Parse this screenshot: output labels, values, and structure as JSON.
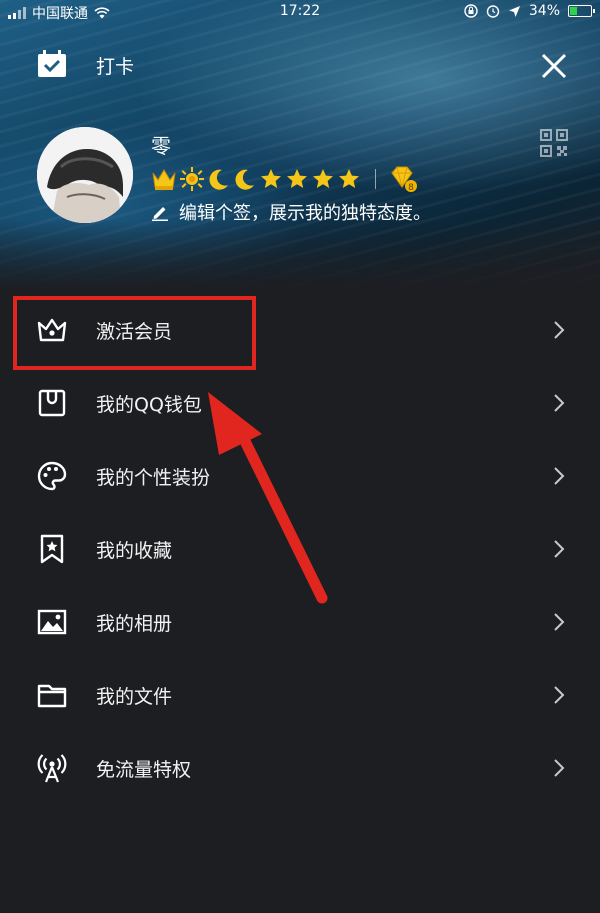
{
  "status_bar": {
    "carrier": "中国联通",
    "time": "17:22",
    "battery": "34%"
  },
  "header": {
    "checkin_label": "打卡"
  },
  "profile": {
    "name": "零",
    "signature": "编辑个签，展示我的独特态度。",
    "badge_level": "8"
  },
  "menu": {
    "items": [
      {
        "label": "激活会员",
        "icon": "crown-icon"
      },
      {
        "label": "我的QQ钱包",
        "icon": "wallet-icon"
      },
      {
        "label": "我的个性装扮",
        "icon": "palette-icon"
      },
      {
        "label": "我的收藏",
        "icon": "bookmark-star-icon"
      },
      {
        "label": "我的相册",
        "icon": "image-icon"
      },
      {
        "label": "我的文件",
        "icon": "folder-icon"
      },
      {
        "label": "免流量特权",
        "icon": "signal-tower-icon"
      }
    ]
  },
  "colors": {
    "background": "#1d1e22",
    "annotation": "#e1261f",
    "text": "#ffffff",
    "gold": "#f5c518"
  }
}
